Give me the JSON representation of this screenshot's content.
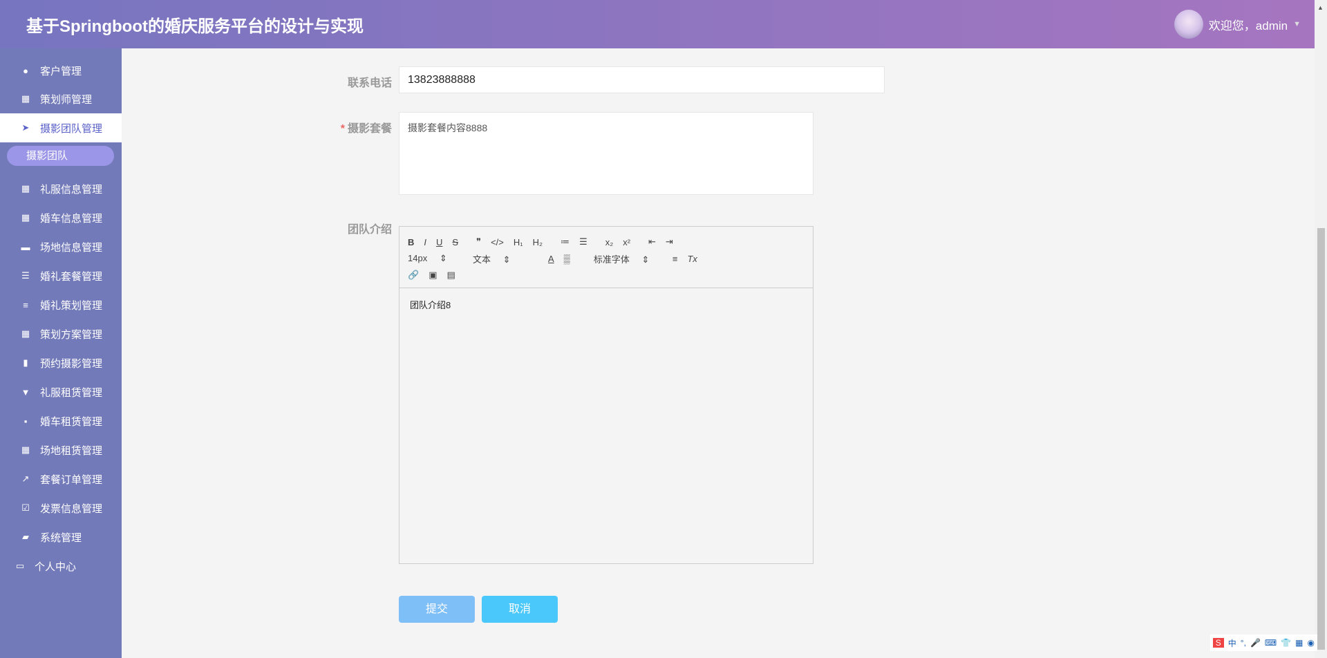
{
  "header": {
    "title": "基于Springboot的婚庆服务平台的设计与实现",
    "welcome": "欢迎您，admin"
  },
  "sidebar": {
    "items": [
      {
        "label": "客户管理",
        "icon": "●"
      },
      {
        "label": "策划师管理",
        "icon": "▦"
      },
      {
        "label": "摄影团队管理",
        "icon": "➤"
      }
    ],
    "sub_item": "摄影团队",
    "items2": [
      {
        "label": "礼服信息管理",
        "icon": "▦"
      },
      {
        "label": "婚车信息管理",
        "icon": "▦"
      },
      {
        "label": "场地信息管理",
        "icon": "▬"
      },
      {
        "label": "婚礼套餐管理",
        "icon": "☰"
      },
      {
        "label": "婚礼策划管理",
        "icon": "≡"
      },
      {
        "label": "策划方案管理",
        "icon": "▦"
      },
      {
        "label": "预约摄影管理",
        "icon": "▮"
      },
      {
        "label": "礼服租赁管理",
        "icon": "▼"
      },
      {
        "label": "婚车租赁管理",
        "icon": "▪"
      },
      {
        "label": "场地租赁管理",
        "icon": "▦"
      },
      {
        "label": "套餐订单管理",
        "icon": "↗"
      },
      {
        "label": "发票信息管理",
        "icon": "☑"
      },
      {
        "label": "系统管理",
        "icon": "▰"
      },
      {
        "label": "个人中心",
        "icon": "▭"
      }
    ]
  },
  "form": {
    "phone_label": "联系电话",
    "phone_value": "13823888888",
    "package_label": "摄影套餐",
    "package_value": "摄影套餐内容8888",
    "intro_label": "团队介绍",
    "intro_content": "团队介绍8",
    "toolbar": {
      "row1": [
        "B",
        "I",
        "U",
        "S",
        "❞",
        "</>",
        "H₁",
        "H₂",
        "≔",
        "☰",
        "x₂",
        "x²",
        "⇤",
        "⇥"
      ],
      "size": "14px",
      "type": "文本",
      "font": "标准字体",
      "row2_icons": [
        "A",
        "▒",
        "≡",
        "Tx"
      ],
      "row3": [
        "🔗",
        "▣",
        "▤"
      ]
    },
    "submit": "提交",
    "cancel": "取消"
  },
  "ime": [
    "S",
    "中",
    "°,",
    "🎤",
    "⌨",
    "👕",
    "▦",
    "◉"
  ]
}
